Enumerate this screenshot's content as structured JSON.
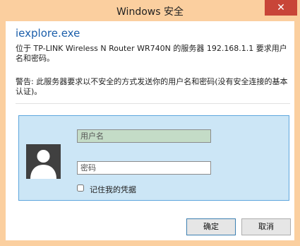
{
  "window": {
    "title": "Windows 安全",
    "close_glyph": "✕"
  },
  "dialog": {
    "app_name": "iexplore.exe",
    "message": "位于 TP-LINK Wireless N Router WR740N 的服务器 192.168.1.1 要求用户名和密码。",
    "warning": "警告: 此服务器要求以不安全的方式发送你的用户名和密码(没有安全连接的基本认证)。"
  },
  "credentials": {
    "username_placeholder": "用户名",
    "username_value": "",
    "password_placeholder": "密码",
    "password_value": "",
    "remember_label": "记住我的凭据",
    "remember_checked": false
  },
  "buttons": {
    "ok_label": "确定",
    "cancel_label": "取消"
  },
  "colors": {
    "frame": "#fbcf9f",
    "close_button": "#c84538",
    "app_name": "#1b5eaa",
    "credential_panel": "#cce6f6",
    "credential_border": "#5fa7dd",
    "username_field": "#c4dcc7",
    "avatar_background": "#404040"
  },
  "icons": {
    "avatar": "user-silhouette-icon",
    "close": "close-icon"
  }
}
